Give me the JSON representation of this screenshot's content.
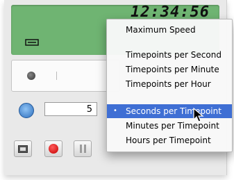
{
  "display": {
    "time": "12:34:56"
  },
  "dial": {},
  "controls": {
    "step_value": "5"
  },
  "menu": {
    "items": [
      {
        "label": "Maximum Speed"
      },
      {
        "label": "Timepoints per Second"
      },
      {
        "label": "Timepoints per Minute"
      },
      {
        "label": "Timepoints per Hour"
      },
      {
        "label": "Seconds per Timepoint",
        "selected": true
      },
      {
        "label": "Minutes per Timepoint"
      },
      {
        "label": "Hours per Timepoint"
      }
    ],
    "checkmark": "•"
  },
  "colors": {
    "lcd": "#6fb472",
    "highlight": "#3f6fd4",
    "record": "#d81e1e"
  }
}
